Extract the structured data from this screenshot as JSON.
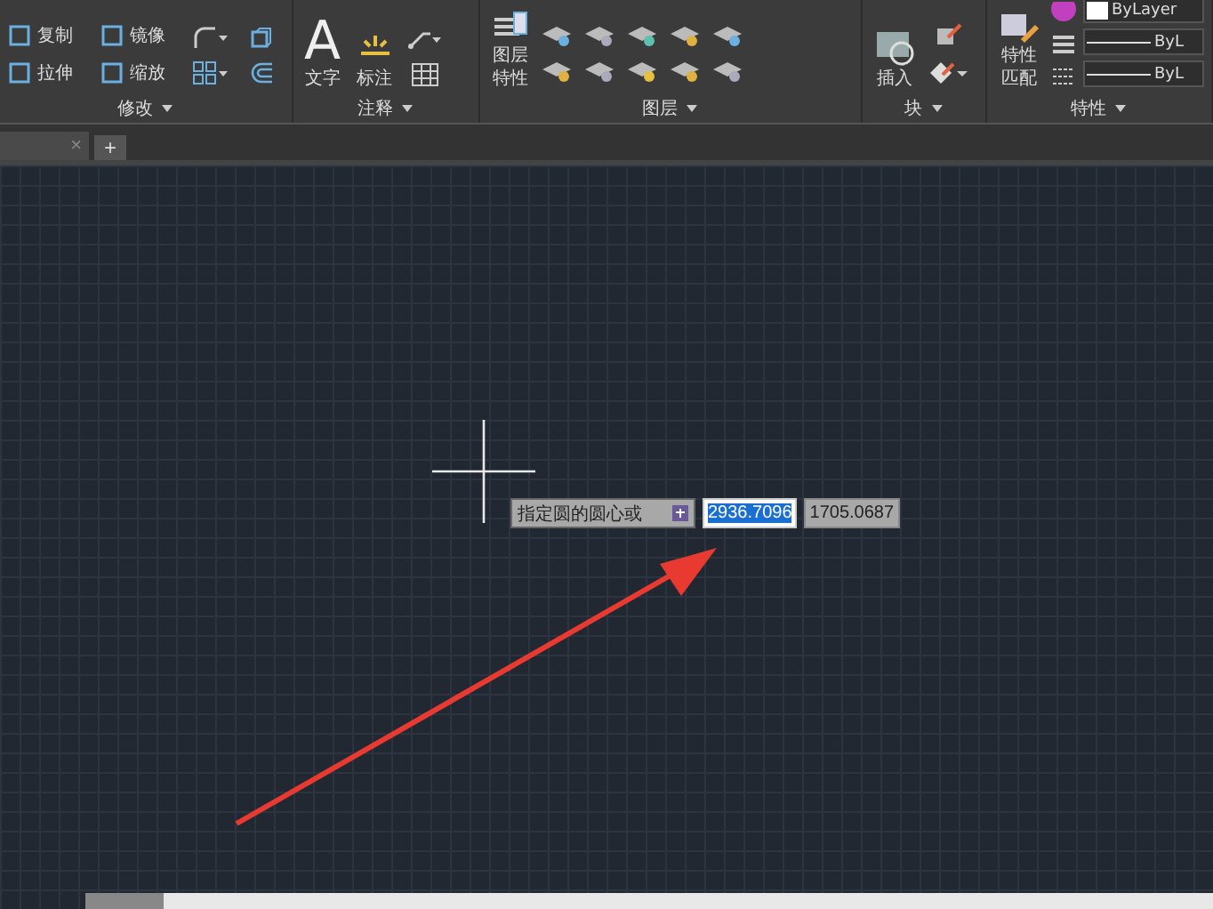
{
  "ribbon": {
    "panels": [
      {
        "title": "修改",
        "tools": [
          {
            "label": "复制"
          },
          {
            "label": "镜像"
          },
          {
            "label": "拉伸"
          },
          {
            "label": "缩放"
          }
        ]
      },
      {
        "title": "注释",
        "tools": [
          {
            "label": "文字",
            "glyph": "A"
          },
          {
            "label": "标注"
          }
        ]
      },
      {
        "title": "图层",
        "tools": [
          {
            "lines": [
              "图层",
              "特性"
            ]
          }
        ]
      },
      {
        "title": "块",
        "tools": [
          {
            "label": "插入"
          }
        ]
      },
      {
        "title": "特性",
        "tools": [
          {
            "lines": [
              "特性",
              "匹配"
            ]
          }
        ],
        "dropdowns": [
          "ByLayer",
          "ByL",
          "ByL"
        ]
      }
    ]
  },
  "file_tabs": {
    "close": "×",
    "add": "+"
  },
  "canvas": {
    "prompt": "指定圆的圆心或",
    "inputs": [
      {
        "value": "2936.7096",
        "selected": true
      },
      {
        "value": "1705.0687",
        "selected": false
      }
    ]
  }
}
